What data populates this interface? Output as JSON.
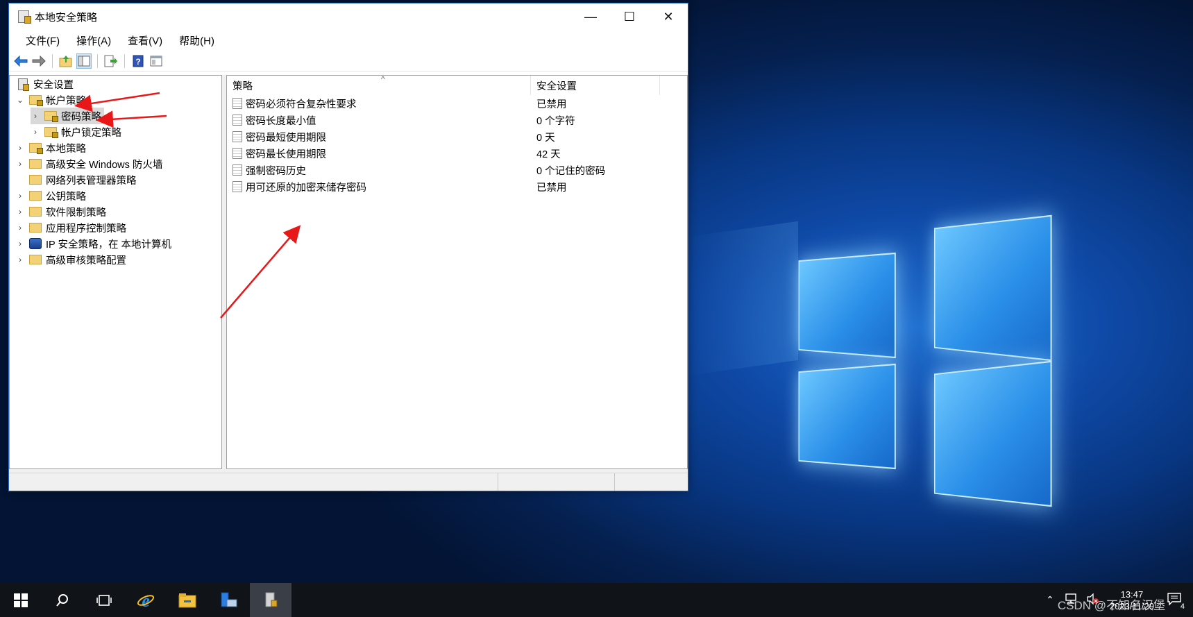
{
  "window": {
    "title": "本地安全策略",
    "controls": {
      "minimize": "—",
      "maximize": "☐",
      "close": "✕"
    }
  },
  "menu": [
    "文件(F)",
    "操作(A)",
    "查看(V)",
    "帮助(H)"
  ],
  "toolbar": [
    "back-icon",
    "forward-icon",
    "up-folder-icon",
    "show-hide-tree-icon",
    "export-list-icon",
    "help-icon",
    "view-icon"
  ],
  "tree": {
    "root": "安全设置",
    "items": [
      {
        "label": "帐户策略",
        "expanded": true
      },
      {
        "label": "密码策略",
        "selected": true
      },
      {
        "label": "帐户锁定策略"
      },
      {
        "label": "本地策略"
      },
      {
        "label": "高级安全 Windows 防火墙"
      },
      {
        "label": "网络列表管理器策略"
      },
      {
        "label": "公钥策略"
      },
      {
        "label": "软件限制策略"
      },
      {
        "label": "应用程序控制策略"
      },
      {
        "label": "IP 安全策略，在 本地计算机"
      },
      {
        "label": "高级审核策略配置"
      }
    ]
  },
  "list": {
    "columns": [
      "策略",
      "安全设置"
    ],
    "rows": [
      {
        "policy": "密码必须符合复杂性要求",
        "setting": "已禁用"
      },
      {
        "policy": "密码长度最小值",
        "setting": "0 个字符"
      },
      {
        "policy": "密码最短使用期限",
        "setting": "0 天"
      },
      {
        "policy": "密码最长使用期限",
        "setting": "42 天"
      },
      {
        "policy": "强制密码历史",
        "setting": "0 个记住的密码"
      },
      {
        "policy": "用可还原的加密来储存密码",
        "setting": "已禁用"
      }
    ]
  },
  "taskbar": {
    "clock_time": "13:47",
    "clock_date": "2023/11/29",
    "notification_count": "4"
  },
  "watermark": "CSDN @不知名汉堡",
  "colors": {
    "annotation_arrow": "#e81818",
    "window_border": "#2a6ad0",
    "taskbar": "#101418"
  }
}
